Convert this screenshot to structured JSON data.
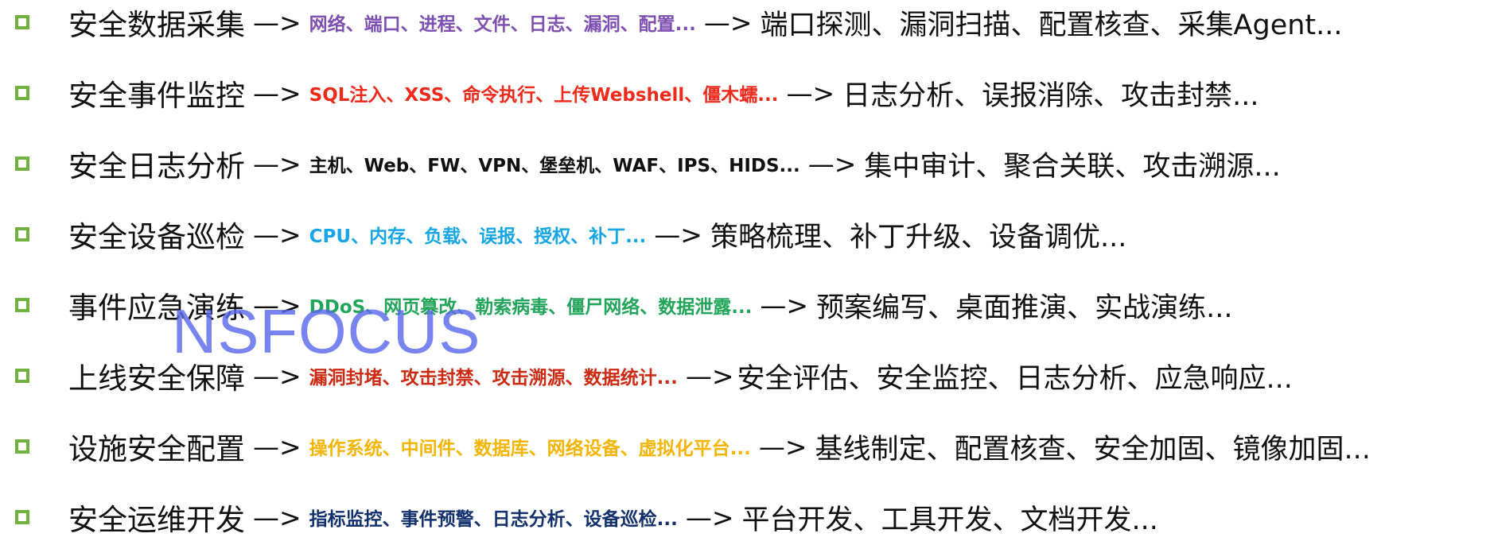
{
  "bullet_color": "#6fb23f",
  "watermark": "NSFOCUS",
  "rows": [
    {
      "title": "安全数据采集",
      "arrow1": "—>",
      "items": "网络、端口、进程、文件、日志、漏洞、配置...",
      "items_color": "#7d4fb0",
      "arrow2": "—>",
      "result": "端口探测、漏洞扫描、配置核查、采集Agent..."
    },
    {
      "title": "安全事件监控",
      "arrow1": "—>",
      "items": "SQL注入、XSS、命令执行、上传Webshell、僵木蠕...",
      "items_color": "#ee2a1a",
      "arrow2": "—>",
      "result": "日志分析、误报消除、攻击封禁..."
    },
    {
      "title": "安全日志分析",
      "arrow1": "—>",
      "items": "主机、Web、FW、VPN、堡垒机、WAF、IPS、HIDS...",
      "items_color": "#111111",
      "arrow2": "—>",
      "result": "集中审计、聚合关联、攻击溯源..."
    },
    {
      "title": "安全设备巡检",
      "arrow1": "—>",
      "items": "CPU、内存、负载、误报、授权、补丁...",
      "items_color": "#16a6e6",
      "arrow2": "—>",
      "result": "策略梳理、补丁升级、设备调优..."
    },
    {
      "title": "事件应急演练",
      "arrow1": "—>",
      "items": "DDoS、网页篡改、勒索病毒、僵尸网络、数据泄露...",
      "items_color": "#22a55a",
      "arrow2": "—>",
      "result": "预案编写、桌面推演、实战演练..."
    },
    {
      "title": "上线安全保障",
      "arrow1": "—>",
      "items": "漏洞封堵、攻击封禁、攻击溯源、数据统计...",
      "items_color": "#cc2a12",
      "arrow2": "—>",
      "result": "安全评估、安全监控、日志分析、应急响应..."
    },
    {
      "title": "设施安全配置",
      "arrow1": "—>",
      "items": "操作系统、中间件、数据库、网络设备、虚拟化平台...",
      "items_color": "#f5b400",
      "arrow2": "—>",
      "result": "基线制定、配置核查、安全加固、镜像加固..."
    },
    {
      "title": "安全运维开发",
      "arrow1": "—>",
      "items": "指标监控、事件预警、日志分析、设备巡检...",
      "items_color": "#12306e",
      "arrow2": "—>",
      "result": "平台开发、工具开发、文档开发..."
    }
  ]
}
